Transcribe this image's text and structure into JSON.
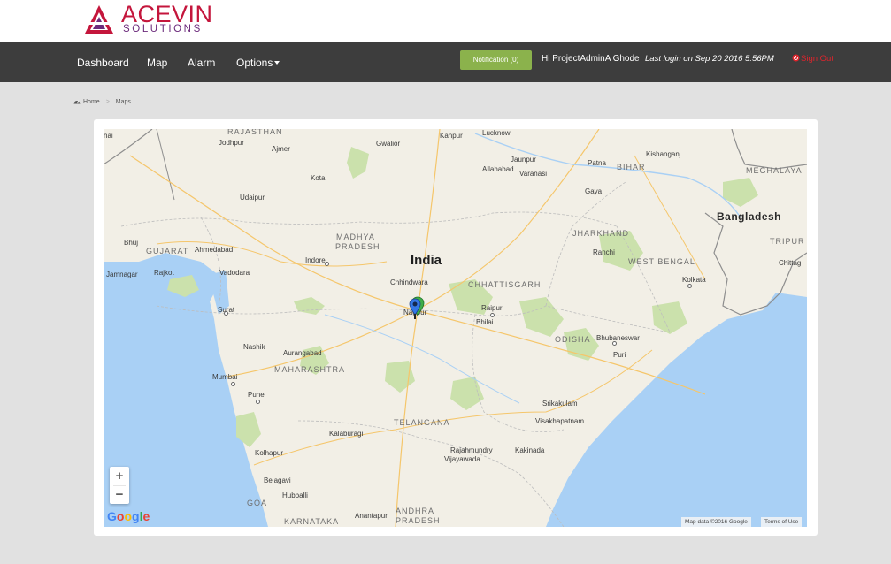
{
  "brand": {
    "name": "ACEVIN",
    "tagline": "SOLUTIONS",
    "colors": {
      "primary": "#c4163c",
      "secondary": "#6b2a7b"
    }
  },
  "nav": {
    "items": [
      {
        "label": "Dashboard"
      },
      {
        "label": "Map"
      },
      {
        "label": "Alarm"
      },
      {
        "label": "Options"
      }
    ],
    "notification_label": "Notification (0)",
    "greeting": "Hi ProjectAdminA Ghode",
    "last_login": "Last login on Sep 20 2016 5:56PM",
    "signout_label": "Sign Out",
    "colors": {
      "bar": "#3d3d3d",
      "notification": "#8bb24c",
      "signout": "#e0242c"
    }
  },
  "breadcrumb": {
    "home": "Home",
    "current": "Maps",
    "home_icon": "dashboard-icon"
  },
  "map": {
    "country": "India",
    "neighbors": [
      "Bangladesh"
    ],
    "states": [
      "RAJASTHAN",
      "MADHYA",
      "PRADESH",
      "GUJARAT",
      "MAHARASHTRA",
      "CHHATTISGARH",
      "JHARKHAND",
      "WEST BENGAL",
      "ODISHA",
      "TELANGANA",
      "ANDHRA",
      "PRADESH",
      "KARNATAKA",
      "GOA",
      "BIHAR",
      "MEGHALAYA",
      "TRIPUR"
    ],
    "cities": [
      "Jodhpur",
      "Ajmer",
      "Gwalior",
      "Kanpur",
      "Lucknow",
      "Allahabad",
      "Jaunpur",
      "Varanasi",
      "Patna",
      "Kishanganj",
      "Kota",
      "Udaipur",
      "Gaya",
      "Bhuj",
      "Ahmedabad",
      "Indore",
      "Ranchi",
      "Jamnagar",
      "Rajkot",
      "Vadodara",
      "Chhindwara",
      "Kolkata",
      "Chittag",
      "Surat",
      "Nagpur",
      "Raipur",
      "Bhilai",
      "Nashik",
      "Aurangabad",
      "Bhubaneswar",
      "Puri",
      "Mumbai",
      "Pune",
      "Srikakulam",
      "Visakhapatnam",
      "Kalaburagi",
      "Kolhapur",
      "Rajahmundry",
      "Kakinada",
      "Vijayawada",
      "Belagavi",
      "Hubballi",
      "Anantapur",
      "hai"
    ],
    "zoom_in": "+",
    "zoom_out": "−",
    "google": "Google",
    "attribution": "Map data ©2016 Google",
    "terms": "Terms of Use",
    "marker_icons": [
      "map-pin-green-icon",
      "map-pin-blue-icon"
    ]
  }
}
